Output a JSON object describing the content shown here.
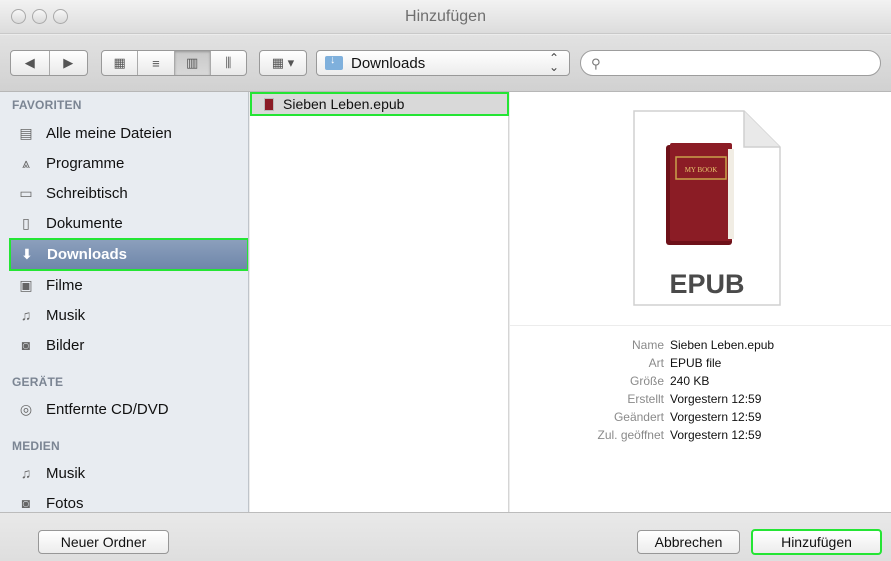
{
  "window": {
    "title": "Hinzufügen"
  },
  "toolbar": {
    "location_label": "Downloads",
    "search_placeholder": "",
    "location_icon": "downloads-folder-icon"
  },
  "sidebar": {
    "favorites_header": "FAVORITEN",
    "devices_header": "GERÄTE",
    "media_header": "MEDIEN",
    "favorites": [
      {
        "label": "Alle meine Dateien",
        "icon": "all-files-icon"
      },
      {
        "label": "Programme",
        "icon": "applications-icon"
      },
      {
        "label": "Schreibtisch",
        "icon": "desktop-icon"
      },
      {
        "label": "Dokumente",
        "icon": "documents-icon"
      },
      {
        "label": "Downloads",
        "icon": "downloads-icon",
        "selected": true
      },
      {
        "label": "Filme",
        "icon": "movies-icon"
      },
      {
        "label": "Musik",
        "icon": "music-icon"
      },
      {
        "label": "Bilder",
        "icon": "pictures-icon"
      }
    ],
    "devices": [
      {
        "label": "Entfernte CD/DVD",
        "icon": "disc-icon"
      }
    ],
    "media": [
      {
        "label": "Musik",
        "icon": "music-icon"
      },
      {
        "label": "Fotos",
        "icon": "photos-icon"
      }
    ]
  },
  "files": [
    {
      "name": "Sieben Leben.epub",
      "icon": "epub-file-icon",
      "selected": true
    }
  ],
  "preview": {
    "doc_label": "EPUB",
    "book_label": "MY BOOK",
    "info": [
      {
        "key": "Name",
        "value": "Sieben Leben.epub"
      },
      {
        "key": "Art",
        "value": "EPUB file"
      },
      {
        "key": "Größe",
        "value": "240 KB"
      },
      {
        "key": "Erstellt",
        "value": "Vorgestern 12:59"
      },
      {
        "key": "Geändert",
        "value": "Vorgestern 12:59"
      },
      {
        "key": "Zul. geöffnet",
        "value": "Vorgestern 12:59"
      }
    ]
  },
  "buttons": {
    "new_folder": "Neuer Ordner",
    "cancel": "Abbrechen",
    "add": "Hinzufügen"
  },
  "colors": {
    "highlight_outline": "#24e534",
    "sidebar_selection": "#7a8fb0",
    "book_red": "#8b1c25"
  }
}
